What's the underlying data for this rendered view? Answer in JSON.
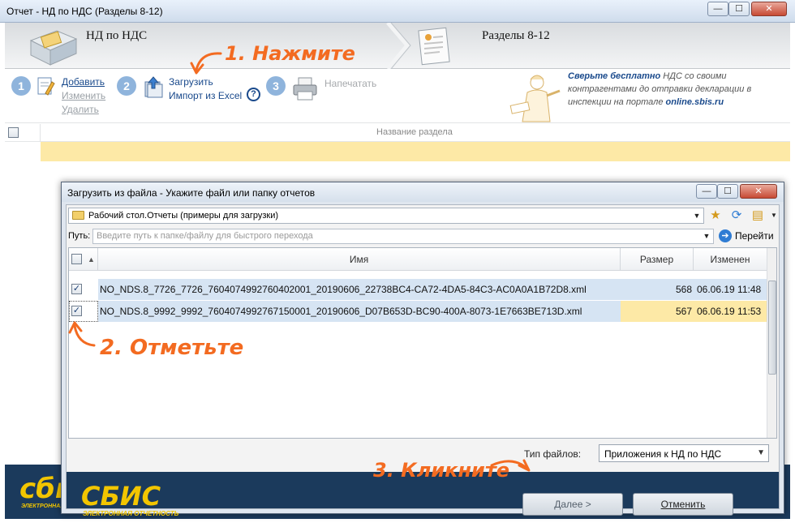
{
  "window": {
    "title": "Отчет - НД по НДС (Разделы 8-12)",
    "buttons": {
      "minimize": "—",
      "maximize": "☐",
      "close": "✕"
    }
  },
  "banner": {
    "left_label": "НД по НДС",
    "right_label": "Разделы 8-12"
  },
  "toolbar": {
    "step1": "1",
    "step2": "2",
    "step3": "3",
    "add": "Добавить",
    "edit": "Изменить",
    "delete": "Удалить",
    "upload": "Загрузить",
    "import_excel": "Импорт из Excel",
    "help": "?",
    "print": "Напечатать"
  },
  "promo": {
    "prefix": "Сверьте бесплатно",
    "text": " НДС со своими контрагентами до отправки декларации в инспекции на портале ",
    "link": "online.sbis.ru"
  },
  "grid": {
    "header": "Название раздела"
  },
  "logo": {
    "text": "СБИС",
    "subtitle": "ЭЛЕКТРОННАЯ ОТЧЕТНОСТЬ"
  },
  "main_logo": {
    "text": "сби",
    "subtitle": "ЭЛЕКТРОННАЯ"
  },
  "dialog": {
    "title": "Загрузить из файла - Укажите файл или папку отчетов",
    "buttons": {
      "minimize": "—",
      "maximize": "☐",
      "close": "✕"
    },
    "folder": "Рабочий стол.Отчеты (примеры для загрузки)",
    "path_label": "Путь:",
    "path_placeholder": "Введите путь к папке/файлу для быстрого перехода",
    "go": "Перейти",
    "columns": {
      "name": "Имя",
      "size": "Размер",
      "modified": "Изменен"
    },
    "files": [
      {
        "name": "NO_NDS.8_7726_7726_7604074992760402001_20190606_22738BC4-CA72-4DA5-84C3-AC0A0A1B72D8.xml",
        "size": "568",
        "modified": "06.06.19 11:48",
        "checked": true
      },
      {
        "name": "NO_NDS.8_9992_9992_7604074992767150001_20190606_D07B653D-BC90-400A-8073-1E7663BE713D.xml",
        "size": "567",
        "modified": "06.06.19 11:53",
        "checked": true
      }
    ],
    "file_type_label": "Тип файлов:",
    "file_type_value": "Приложения к НД по НДС",
    "next": "Далее >",
    "cancel": "Отменить"
  },
  "annotations": {
    "step1": "1. Нажмите",
    "step2": "2. Отметьте",
    "step3": "3. Кликните"
  },
  "colors": {
    "accent": "#f36b21",
    "footer": "#1b3a5c",
    "logo": "#f2c500",
    "highlight": "#fde9a6",
    "selected": "#d6e4f3"
  }
}
